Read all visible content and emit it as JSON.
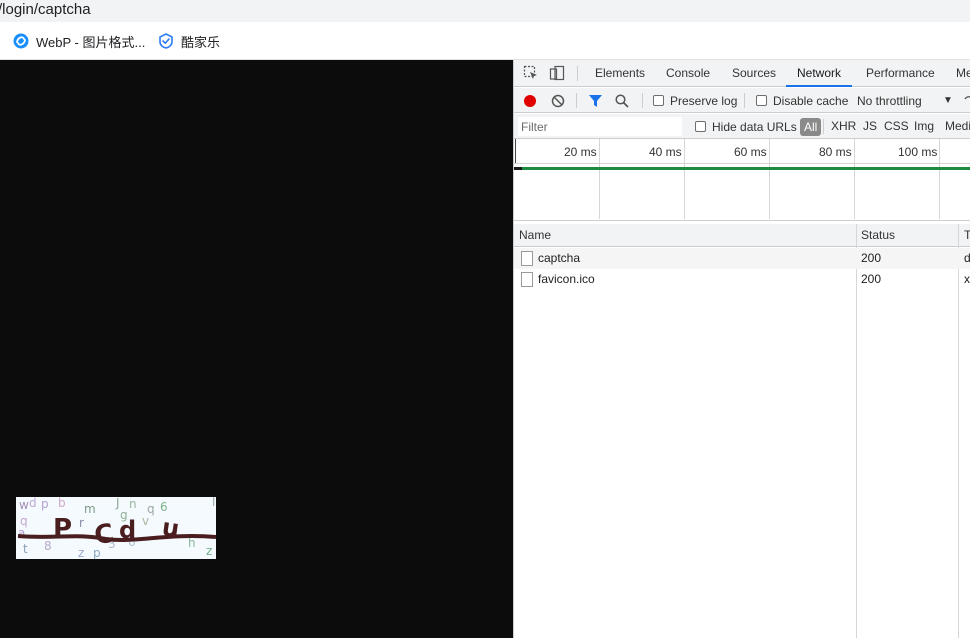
{
  "address_bar": {
    "url_text": "/login/captcha"
  },
  "bookmarks": [
    {
      "label": "WebP - 图片格式...",
      "icon": "webp-logo-icon",
      "color": "#1a90ff"
    },
    {
      "label": "酷家乐",
      "icon": "kujiale-shield-icon",
      "color": "#2d7cf6"
    }
  ],
  "captcha": {
    "glyphs": "P C d u",
    "noise_chars": [
      "w",
      "d",
      "p",
      "J",
      "n",
      "q",
      "6",
      "m",
      "z",
      "8",
      "v",
      "h",
      "g",
      "t",
      "r"
    ]
  },
  "devtools": {
    "tabs": [
      {
        "label": "Elements",
        "active": false
      },
      {
        "label": "Console",
        "active": false
      },
      {
        "label": "Sources",
        "active": false
      },
      {
        "label": "Network",
        "active": true
      },
      {
        "label": "Performance",
        "active": false
      },
      {
        "label": "Me",
        "active": false
      }
    ],
    "toolbar": {
      "record_color": "#e00000",
      "preserve_log": "Preserve log",
      "disable_cache": "Disable cache",
      "throttling": "No throttling",
      "throttling_arrow": "▼"
    },
    "filter": {
      "placeholder": "Filter",
      "hide_data_urls": "Hide data URLs",
      "types": [
        "All",
        "XHR",
        "JS",
        "CSS",
        "Img",
        "Medi"
      ]
    },
    "timeline": {
      "ticks": [
        "20 ms",
        "40 ms",
        "60 ms",
        "80 ms",
        "100 ms"
      ]
    },
    "table": {
      "headers": [
        "Name",
        "Status",
        "T"
      ],
      "rows": [
        {
          "name": "captcha",
          "status": "200",
          "type": "d"
        },
        {
          "name": "favicon.ico",
          "status": "200",
          "type": "x"
        }
      ]
    }
  }
}
